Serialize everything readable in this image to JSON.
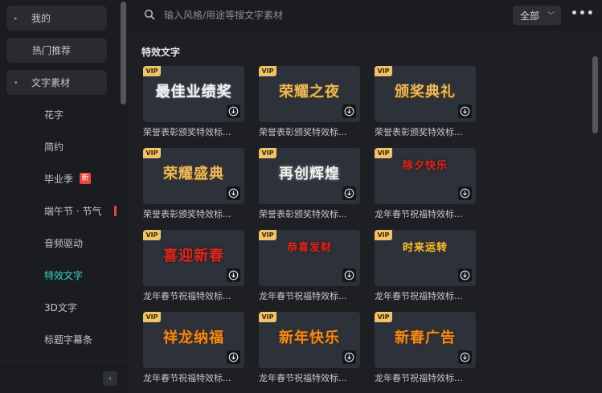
{
  "sidebar": {
    "items": [
      {
        "label": "我的",
        "caret": "▸"
      },
      {
        "label": "热门推荐"
      },
      {
        "label": "文字素材",
        "caret": "▾"
      }
    ],
    "subitems": [
      {
        "label": "花字"
      },
      {
        "label": "简约"
      },
      {
        "label": "毕业季",
        "badge": "新"
      },
      {
        "label": "端午节 · 节气"
      },
      {
        "label": "音频驱动"
      },
      {
        "label": "特效文字"
      },
      {
        "label": "3D文字"
      },
      {
        "label": "标题字幕条"
      }
    ],
    "collapse_icon": "‹"
  },
  "search": {
    "placeholder": "输入风格/用途等搜文字素材"
  },
  "filter": {
    "selected": "全部"
  },
  "section_title": "特效文字",
  "vip_label": "VIP",
  "colors": {
    "accent": "#38d5c9",
    "vip": "#f0c36a",
    "badge": "#e8453c"
  },
  "cards": [
    {
      "art": "最佳业绩奖",
      "caption": "荣誉表彰颁奖特效标..."
    },
    {
      "art": "荣耀之夜",
      "caption": "荣誉表彰颁奖特效标..."
    },
    {
      "art": "颁奖典礼",
      "caption": "荣誉表彰颁奖特效标..."
    },
    {
      "art": "荣耀盛典",
      "caption": "荣誉表彰颁奖特效标..."
    },
    {
      "art": "再创辉煌",
      "caption": "荣誉表彰颁奖特效标..."
    },
    {
      "art": "除夕快乐",
      "caption": "龙年春节祝福特效标..."
    },
    {
      "art": "喜迎新春",
      "caption": "龙年春节祝福特效标..."
    },
    {
      "art": "恭喜发财",
      "caption": "龙年春节祝福特效标..."
    },
    {
      "art": "时来运转",
      "caption": "龙年春节祝福特效标..."
    },
    {
      "art": "祥龙纳福",
      "caption": "龙年春节祝福特效标..."
    },
    {
      "art": "新年快乐",
      "caption": "龙年春节祝福特效标..."
    },
    {
      "art": "新春广告",
      "caption": "龙年春节祝福特效标..."
    }
  ]
}
